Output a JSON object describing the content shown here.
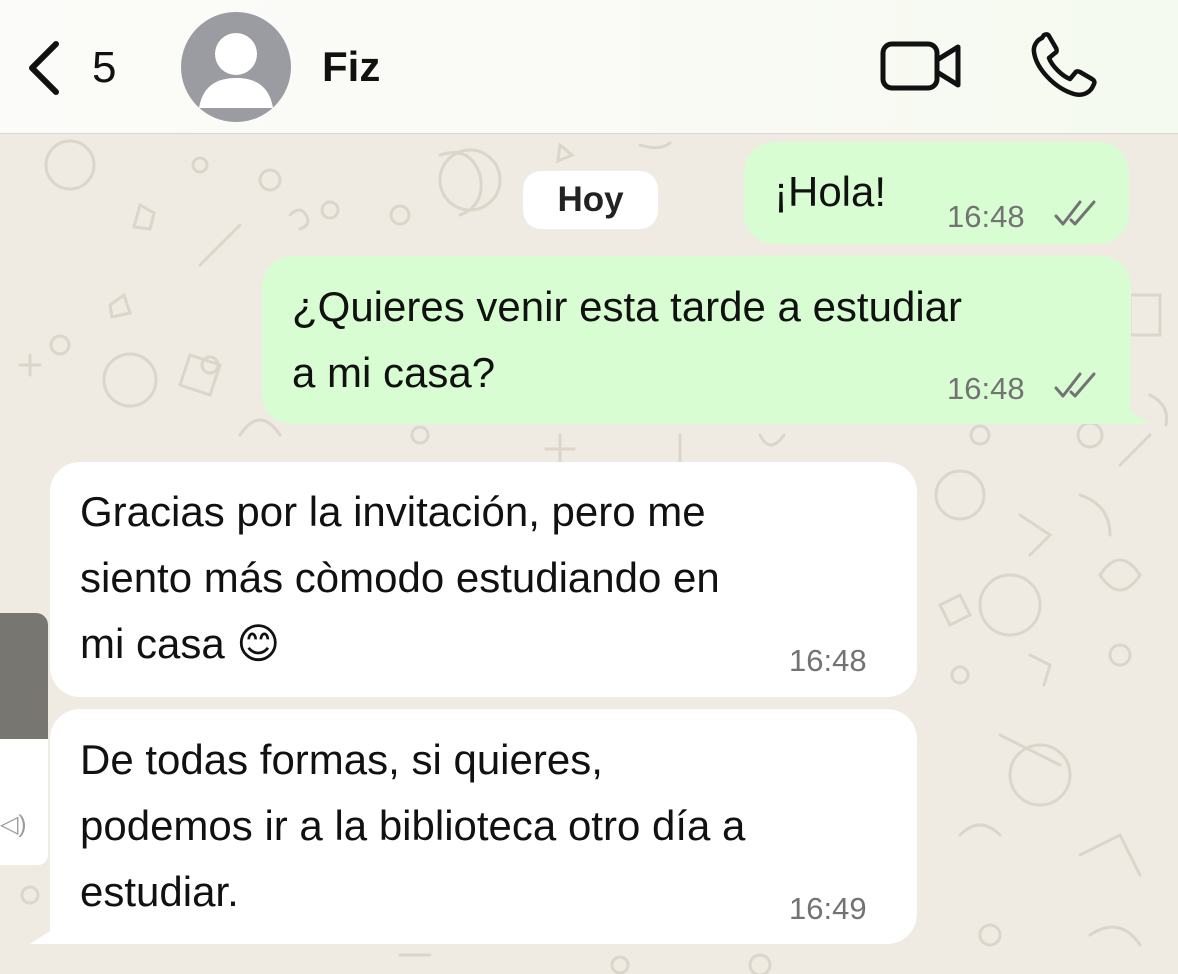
{
  "header": {
    "back_count": "5",
    "contact_name": "Fiz"
  },
  "chat": {
    "day_label": "Hoy",
    "messages": [
      {
        "direction": "outgoing",
        "text": "¡Hola!",
        "time": "16:48",
        "status": "read"
      },
      {
        "direction": "outgoing",
        "text": "¿Quieres venir esta tarde a estudiar\na mi casa?",
        "time": "16:48",
        "status": "read"
      },
      {
        "direction": "incoming",
        "text": "Gracias por la invitación, pero me\nsiento más còmodo estudiando en\nmi casa 😊",
        "time": "16:48"
      },
      {
        "direction": "incoming",
        "text": "De todas formas, si quieres,\npodemos ir a la biblioteca otro día a\nestudiar.",
        "time": "16:49"
      }
    ]
  },
  "icons": {
    "back": "chevron-left-icon",
    "avatar": "person-silhouette-icon",
    "video": "video-camera-icon",
    "call": "phone-icon",
    "read_receipt": "double-check-icon",
    "speaker": "speaker-icon"
  },
  "colors": {
    "outgoing_bubble": "#d9fdd3",
    "incoming_bubble": "#ffffff",
    "chat_background": "#efeae2",
    "timestamp": "#737373"
  }
}
